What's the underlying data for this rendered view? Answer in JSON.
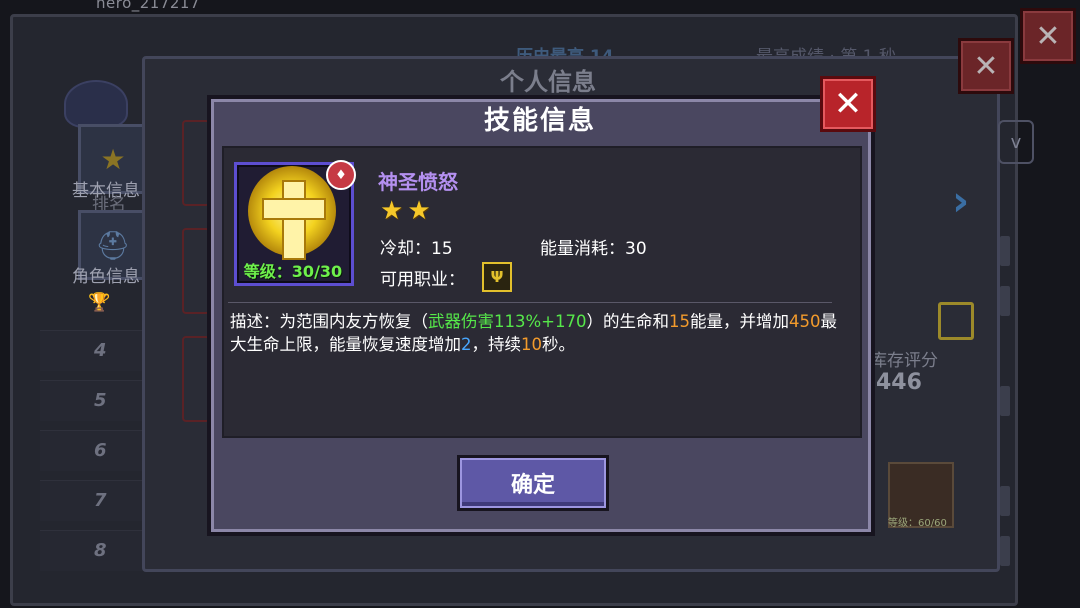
{
  "background": {
    "player_name": "hero_217217",
    "outer_header_left": "历史最高 14",
    "outer_header_right": "最高成绩 · 第 1 秒",
    "inner_title": "个人信息",
    "side_tabs": [
      {
        "label": "基本信息",
        "sub": "排名",
        "icon": "star-icon"
      },
      {
        "label": "角色信息",
        "icon": "helmet-icon"
      }
    ],
    "rank_numbers": [
      "4",
      "5",
      "6",
      "7",
      "8"
    ],
    "dropdown_value": "v",
    "score_label": "库存评分",
    "score_value": "446",
    "mini_skill_level": "等级：60/60"
  },
  "dialog": {
    "title": "技能信息",
    "close_label": "✕",
    "skill": {
      "name": "神圣愤怒",
      "level_text": "等级：30/30",
      "stars": 2,
      "badge_icon": "fire-icon",
      "cooldown_label": "冷却：",
      "cooldown_value": "15",
      "energy_label": "能量消耗：",
      "energy_value": "30",
      "class_label": "可用职业：",
      "class_icon": "priest-staff-icon"
    },
    "description": {
      "prefix": "描述：为范围内友方恢复（",
      "weapon_damage": "武器伤害113%+170",
      "mid1": "）的生命和",
      "energy": "15",
      "mid2": "能量，并增加",
      "max_hp": "450",
      "mid3": "最大生命上限，能量恢复速度增加",
      "regen": "2",
      "mid4": "，持续",
      "duration": "10",
      "suffix": "秒。"
    },
    "confirm_label": "确定"
  },
  "colors": {
    "dialog_bg": "#4a4760",
    "inner_bg": "#2b2a34",
    "skill_name": "#b490f0",
    "level_green": "#6ef04c",
    "highlight_green": "#56e84a",
    "highlight_orange": "#f39b2c",
    "highlight_blue": "#48a7ff",
    "confirm_button": "#5e58a6",
    "close_red": "#b8242a"
  }
}
